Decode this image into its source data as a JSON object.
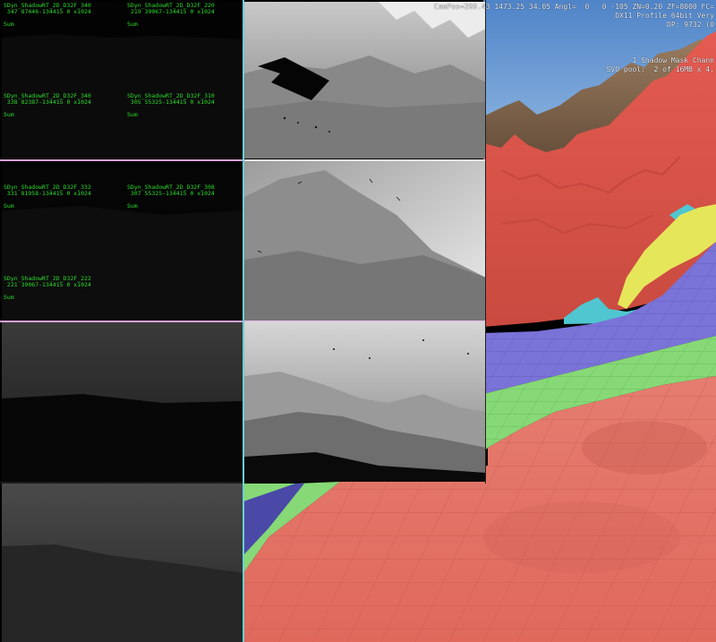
{
  "hud": {
    "line1": "CamPos=269.43 1473.25 34.05 Angl=  0   0 -105 ZN=0.20 ZF=8000 FC=",
    "line2": "DX11 Profile 64bit Very",
    "line3": "DP: 9732 (0",
    "line4": "1 Shadow Mask Chann",
    "line5": "SVO pool:  2 of 16MB x 4."
  },
  "debug_panels": [
    {
      "name": "SDyn_ShadowRT_2D_D32F_340",
      "info": " 347 87446-134415 0 x1024",
      "sum": "Sum"
    },
    {
      "name": "SDyn_ShadowRT_2D_D32F_220",
      "info": " 219 39067-134415 0 x1024",
      "sum": "Sum"
    },
    {
      "name": "SDyn_ShadowRT_2D_D32F_340",
      "info": " 338 82387-134415 0 x1024",
      "sum": "Sum"
    },
    {
      "name": "SDyn_ShadowRT_2D_D32F_310",
      "info": " 305 55325-134415 0 x1024",
      "sum": "Sum"
    },
    {
      "name": "SDyn_ShadowRT_2D_D32F_332",
      "info": " 331 81958-134415 0 x1024",
      "sum": "Sum"
    },
    {
      "name": "SDyn_ShadowRT_2D_D32F_308",
      "info": " 307 55325-134415 0 x1024",
      "sum": "Sum"
    },
    {
      "name": "SDyn_ShadowRT_2D_D32F_222",
      "info": " 221 39067-134415 0 x1024",
      "sum": "Sum"
    }
  ],
  "colors": {
    "label_green": "#2bdc2b",
    "cascade_red": "#e8695a",
    "cascade_green": "#86d976",
    "cascade_blue": "#7a73d8",
    "cascade_yellow": "#e8e85a",
    "cascade_cyan": "#4fc6d0",
    "sky": "#6c9ad3"
  }
}
